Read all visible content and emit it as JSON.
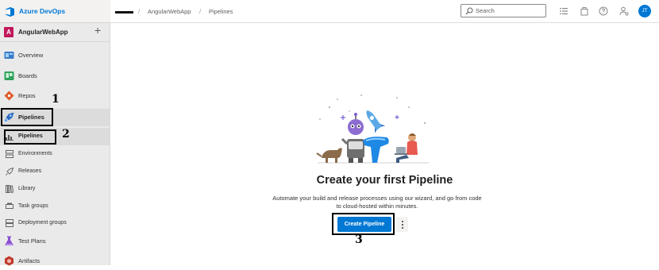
{
  "brand": {
    "name": "Azure DevOps"
  },
  "project": {
    "initial": "A",
    "name": "AngularWebApp",
    "add_symbol": "+"
  },
  "sidebar": {
    "items": [
      {
        "label": "Overview",
        "icon": "overview-icon"
      },
      {
        "label": "Boards",
        "icon": "boards-icon"
      },
      {
        "label": "Repos",
        "icon": "repos-icon"
      },
      {
        "label": "Pipelines",
        "icon": "pipelines-icon"
      },
      {
        "label": "Pipelines",
        "icon": "pipelines-sub-icon"
      },
      {
        "label": "Environments",
        "icon": "environments-icon"
      },
      {
        "label": "Releases",
        "icon": "releases-icon"
      },
      {
        "label": "Library",
        "icon": "library-icon"
      },
      {
        "label": "Task groups",
        "icon": "task-groups-icon"
      },
      {
        "label": "Deployment groups",
        "icon": "deployment-groups-icon"
      },
      {
        "label": "Test Plans",
        "icon": "test-plans-icon"
      },
      {
        "label": "Artifacts",
        "icon": "artifacts-icon"
      }
    ]
  },
  "breadcrumb": {
    "project": "AngularWebApp",
    "page": "Pipelines",
    "separator": "/"
  },
  "search": {
    "placeholder": "Search"
  },
  "user": {
    "initials": "JT"
  },
  "main": {
    "title": "Create your first Pipeline",
    "description": "Automate your build and release processes using our wizard, and go from code to cloud-hosted within minutes.",
    "primary_button": "Create Pipeline"
  },
  "annotations": {
    "step1": "1",
    "step2": "2",
    "step3": "3"
  },
  "colors": {
    "accent": "#0078d4",
    "sidebar_bg": "#eaeaea",
    "project_badge": "#c2185b"
  }
}
